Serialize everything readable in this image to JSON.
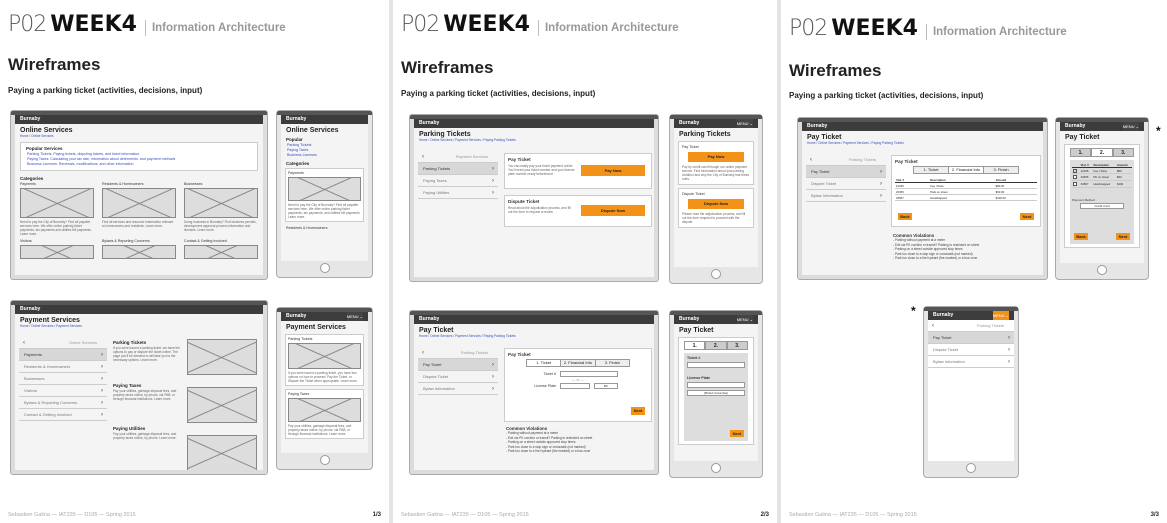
{
  "slides": [
    {
      "po": "P02",
      "week": "WEEK4",
      "ia": "Information Architecture",
      "wf": "Wireframes",
      "sub": "Paying a parking ticket (activities, decisions, input)",
      "footer": "Sebastien Galina — IAT235 — D105 — Spring 2015",
      "page": "1/3"
    },
    {
      "po": "P02",
      "week": "WEEK4",
      "ia": "Information Architecture",
      "wf": "Wireframes",
      "sub": "Paying a parking ticket (activities, decisions, input)",
      "footer": "Sebastien Galina — IAT235 — D105 — Spring 2015",
      "page": "2/3"
    },
    {
      "po": "P02",
      "week": "WEEK4",
      "ia": "Information Architecture",
      "wf": "Wireframes",
      "sub": "Paying a parking ticket (activities, decisions, input)",
      "footer": "Sebastien Galina — IAT235 — D105 — Spring 2015",
      "page": "3/3"
    }
  ],
  "app": {
    "brand": "Burnaby",
    "menu": "MENU ⌄"
  },
  "online": {
    "title": "Online Services",
    "bc": "Home / Online Services",
    "popular": "Popular Services",
    "links": [
      "Parking Tickets, Paying tickets, disputing tickets, and ticket information",
      "Paying Taxes: Calculating your tax rate, information about deferments, and payment methods",
      "Business Licenses: Renewals, modifications, and other information"
    ],
    "categories": "Categories",
    "cats": [
      "Payments",
      "Residents & Homeowners",
      "Businesses",
      "Visitors",
      "Bylaws & Reporting Concerns",
      "Contact & Getting Involved"
    ],
    "catdesc": [
      "Need to pay the City of Burnaby? Find all payable services here. We offer online parking ticket payments, tax payments and utilities bill payments. Learn more.",
      "Find all services and resource information relevant to homeowners and residents. Learn more.",
      "Doing business in Burnaby? Find business permits, development approval process information and licenses. Learn more."
    ],
    "phone_title": "Online Services",
    "phone_popular": "Popular",
    "phone_links": [
      "Parking Tickets",
      "Paying Taxes",
      "Business Licenses"
    ],
    "phone_desc": "Need to pay the City of Burnaby? Find all payable services here. We offer online parking ticket payments, tax payments, and utilities bill payments. Learn more.",
    "phone_res": "Residents & Homeowners"
  },
  "payment": {
    "title": "Payment Services",
    "bc": "Home / Online Services / Payment Services",
    "back": "Online Services",
    "nav": [
      "Payments",
      "Residents & Homeowners",
      "Businesses",
      "Visitors",
      "Bylaws & Reporting Concerns",
      "Contact & Getting Involved"
    ],
    "secs": [
      "Parking Tickets",
      "Paying Taxes",
      "Paying Utilities"
    ],
    "desc": [
      "If you were issued a parking ticket, we have the options to pay or dispute the ticket online. The page you'll be directed to will take you to the necessary options. Learn more.",
      "Pay your utilities, garbage disposal fees, and property taxes online, by phone, via PAB, or through financial institutions. Learn more.",
      "Pay your utilities, garbage disposal fees, and property taxes online, by phone. Learn more."
    ],
    "phone_desc": "If you were issued a parking ticket, you have two options on how to proceed. Pay the Ticket, or Dispute the Ticket when appropriate. Learn more.",
    "phone_desc2": "Pay your utilities, garbage disposal fees, and property taxes online, by phone, via PAB, or through financial institutions. Learn more."
  },
  "tickets": {
    "title": "Parking Tickets",
    "bc": "Home / Online Services / Payment Services / Paying Parking Tickets",
    "back": "Payment Services",
    "nav": [
      "Parking Tickets",
      "Paying Taxes",
      "Paying Utilities"
    ],
    "pay_h": "Pay Ticket",
    "pay_desc": "You can easily pay your ticket payment online. You'll need your ticket number and your license plate number ready beforehand.",
    "pay_btn": "Pay Now",
    "dis_h": "Dispute Ticket",
    "dis_desc": "Read about the adjudication process, and fill out the form to request a review.",
    "dis_btn": "Dispute Now",
    "phone_pay_desc": "Pay by credit card through our online payment service. Find information about your parking violation and why the City of Burnaby has these rules.",
    "phone_dis_desc": "Please read the adjudication process, and fill out the form required to proceed with the dispute."
  },
  "payticket": {
    "title": "Pay Ticket",
    "bc": "Home / Online Services / Payment Services / Paying Parking Tickets",
    "back": "Parking Tickets",
    "nav": [
      "Pay Ticket",
      "Dispute Ticket",
      "Bylaw Information"
    ],
    "steps": [
      "1. Ticket",
      "2. Financial Info",
      "3. Finish"
    ],
    "tno": "Ticket #",
    "or": "— or —",
    "plate": "License Plate",
    "prov": "BC",
    "next": "Next",
    "cv_h": "Common Violations",
    "cv": [
      "- Parking without payment at a meter",
      "- Exit via PK corridor or transit? Parking is restricted on street",
      "- Parking on a street outside approved stop times",
      "- Park too close to a stop sign or crosswalk (not marked)",
      "- Park too close to a fire hydrant (fire marked) or a bus zone"
    ],
    "phone_steps": [
      "1.",
      "2.",
      "3."
    ],
    "phone_tno": "Ticket #",
    "phone_plate": "License Plate",
    "phone_prov": "[British Columbia]",
    "phone_next": "Next"
  },
  "step2": {
    "title": "Pay Ticket",
    "cols": [
      "Viol. #",
      "Description",
      "Amount"
    ],
    "rows": [
      [
        "12345",
        "Fee / Pass",
        "$80.00"
      ],
      [
        "23456",
        "Park on street",
        "$60.00"
      ],
      [
        "34567",
        "Handicapped",
        "$100.00"
      ]
    ],
    "payment_method": "Payment Method",
    "card": "Credit Card",
    "back": "Back",
    "next": "Next",
    "phone_rows": [
      [
        "12345",
        "Fee / Pass",
        "$80"
      ],
      [
        "23456",
        "PK on street",
        "$60"
      ],
      [
        "34567",
        "Handicapped",
        "$100"
      ]
    ]
  },
  "menu_phone": {
    "items": [
      "Pay Ticket",
      "Dispute Ticket",
      "Bylaw Information"
    ],
    "back": "Parking Tickets",
    "menu": "MENU ⌄"
  }
}
